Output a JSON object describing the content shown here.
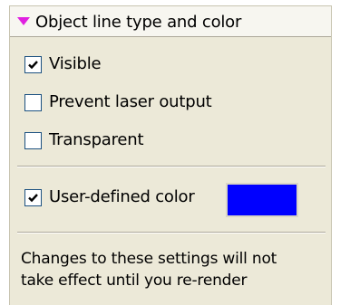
{
  "panel": {
    "title": "Object line type and color",
    "title_icon": "magenta-triangle-down-icon",
    "accent_color": "#e020e0"
  },
  "options": {
    "visible": {
      "label": "Visible",
      "checked": true
    },
    "prevent_laser_output": {
      "label": "Prevent laser output",
      "checked": false
    },
    "transparent": {
      "label": "Transparent",
      "checked": false
    },
    "user_defined_color": {
      "label": "User-defined color",
      "checked": true,
      "color": "#0000ff"
    }
  },
  "note": {
    "line1": "Changes to these settings will not",
    "line2": "take effect until you re-render"
  }
}
